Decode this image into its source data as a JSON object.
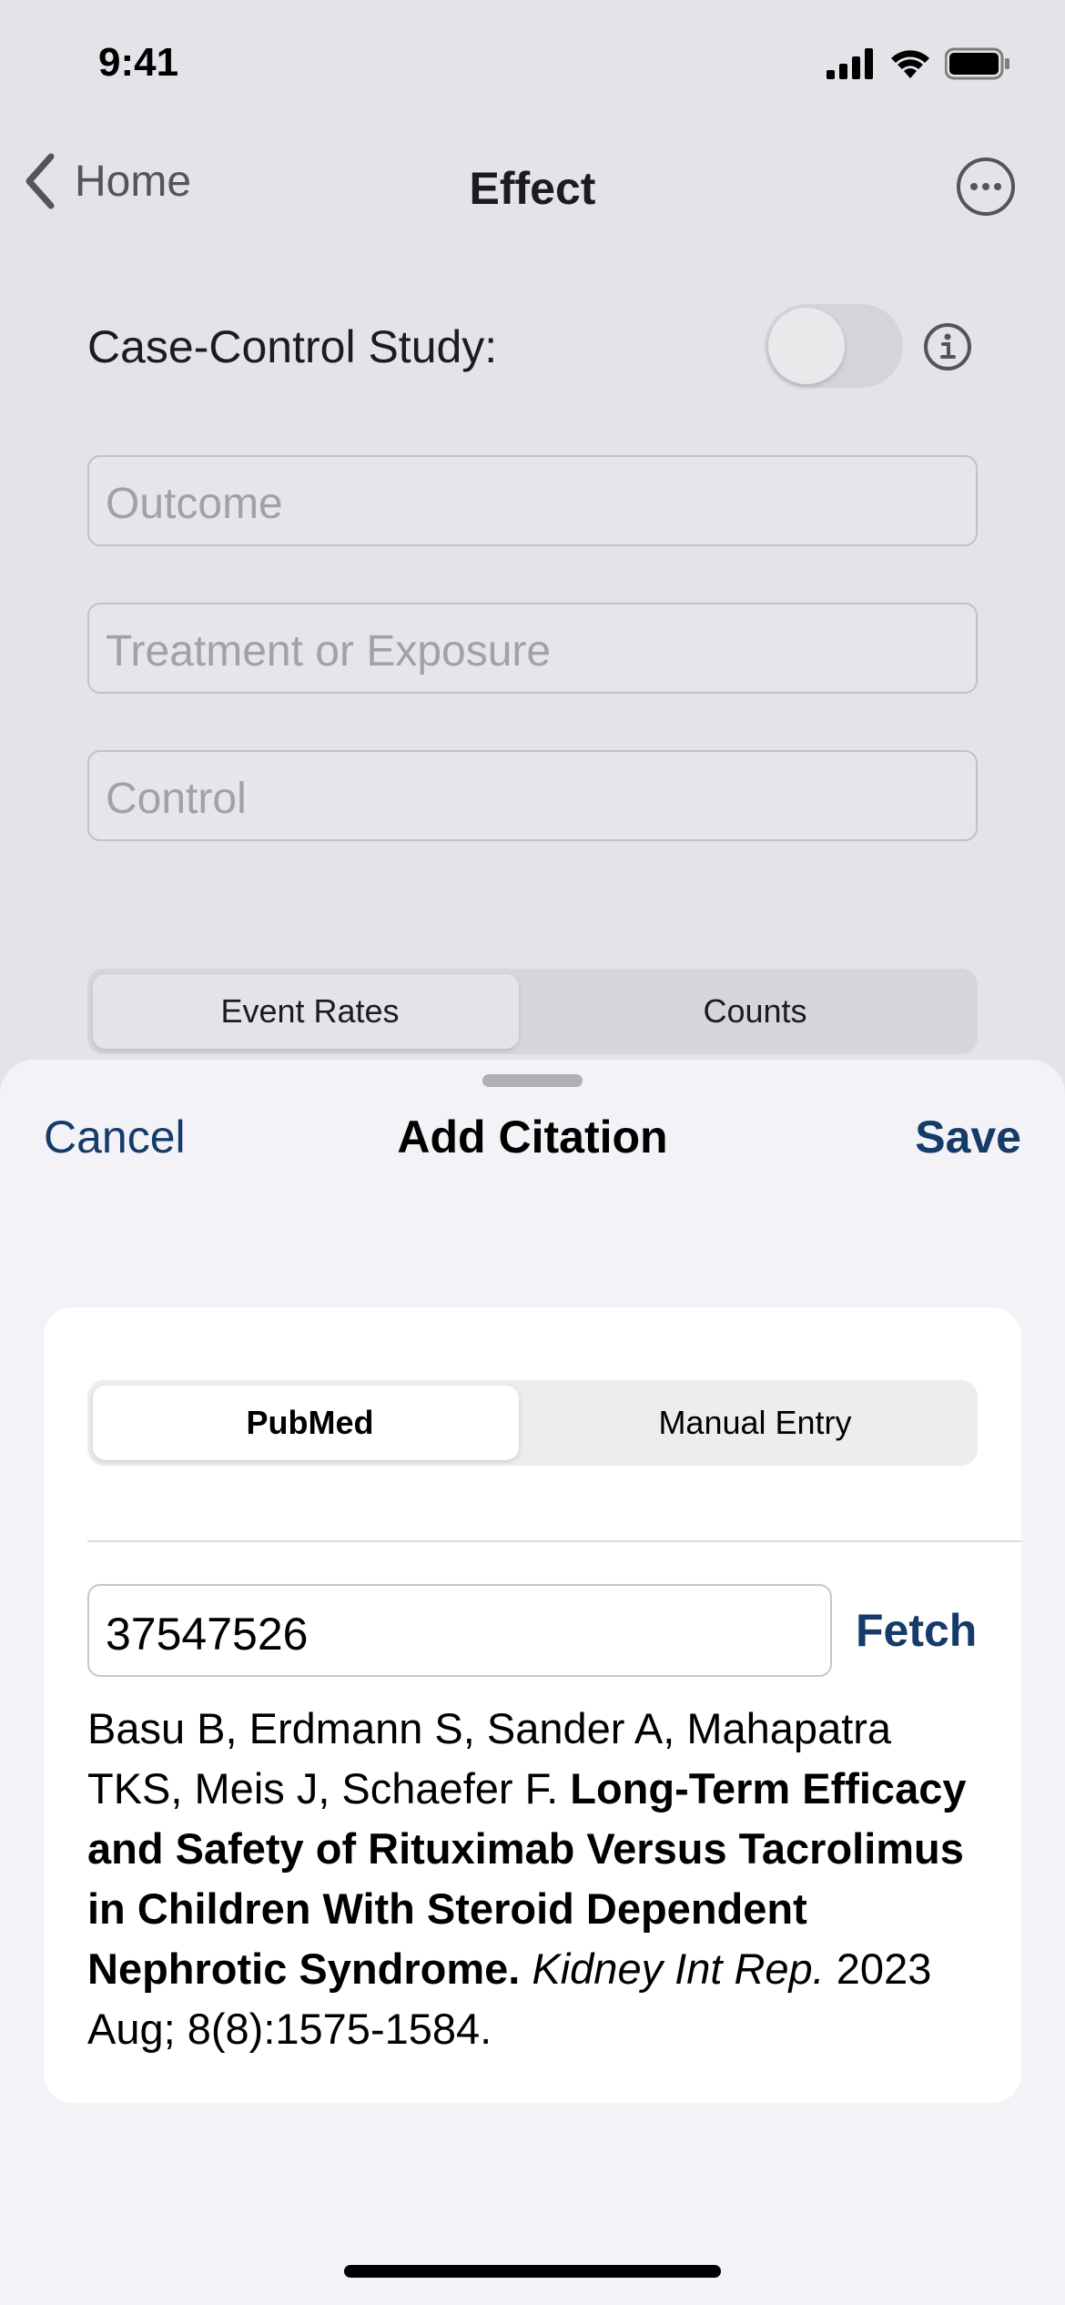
{
  "status_bar": {
    "time": "9:41"
  },
  "nav": {
    "back_label": "Home",
    "title": "Effect"
  },
  "form": {
    "case_control_label": "Case-Control Study:",
    "case_control_on": false,
    "outcome_placeholder": "Outcome",
    "treatment_placeholder": "Treatment or Exposure",
    "control_placeholder": "Control",
    "segments": [
      "Event Rates",
      "Counts"
    ],
    "selected_segment": "Event Rates"
  },
  "sheet": {
    "cancel_label": "Cancel",
    "title": "Add Citation",
    "save_label": "Save",
    "source_segments": [
      "PubMed",
      "Manual Entry"
    ],
    "selected_source": "PubMed",
    "pmid_value": "37547526",
    "fetch_label": "Fetch",
    "citation": {
      "authors": "Basu B, Erdmann S, Sander A, Mahapatra TKS, Meis J, Schaefer F.",
      "title": "Long-Term Efficacy and Safety of Rituximab Versus Tacrolimus in Children With Steroid Dependent Nephrotic Syndrome.",
      "journal": "Kidney Int Rep.",
      "details": "2023 Aug; 8(8):1575-1584."
    }
  },
  "colors": {
    "accent": "#153b6a",
    "background": "#e4e3e8",
    "sheet": "#f2f2f7"
  }
}
